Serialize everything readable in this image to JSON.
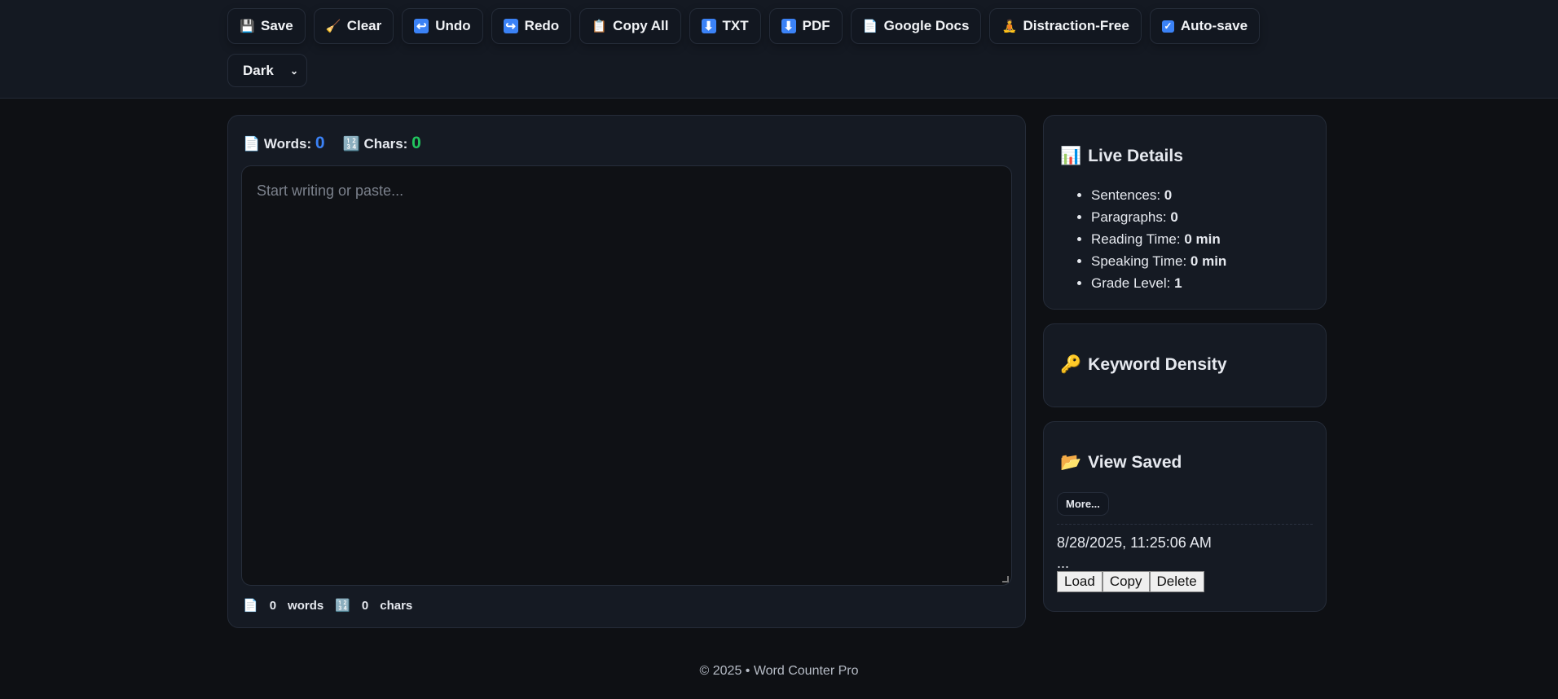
{
  "toolbar": {
    "buttons": [
      {
        "icon": "💾",
        "label": "Save"
      },
      {
        "icon": "🧹",
        "label": "Clear"
      },
      {
        "icon": "↩",
        "label": "Undo"
      },
      {
        "icon": "↪",
        "label": "Redo"
      },
      {
        "icon": "📋",
        "label": "Copy All"
      },
      {
        "icon": "⬇",
        "label": "TXT"
      },
      {
        "icon": "⬇",
        "label": "PDF"
      },
      {
        "icon": "📄",
        "label": "Google Docs"
      },
      {
        "icon": "🧘",
        "label": "Distraction-Free"
      },
      {
        "icon": "☑",
        "label": "Auto-save"
      }
    ],
    "theme_select": "Dark"
  },
  "editor": {
    "words_label": "Words:",
    "words": "0",
    "chars_label": "Chars:",
    "chars": "0",
    "placeholder": "Start writing or paste...",
    "bottom_words": "0",
    "bottom_words_label": "words",
    "bottom_chars": "0",
    "bottom_chars_label": "chars"
  },
  "live": {
    "title": "Live Details",
    "items": [
      {
        "label": "Sentences: ",
        "value": "0"
      },
      {
        "label": "Paragraphs: ",
        "value": "0"
      },
      {
        "label": "Reading Time: ",
        "value": "0 min"
      },
      {
        "label": "Speaking Time: ",
        "value": "0 min"
      },
      {
        "label": "Grade Level: ",
        "value": "1"
      }
    ]
  },
  "keyword": {
    "title": "Keyword Density"
  },
  "saved": {
    "title": "View Saved",
    "more": "More...",
    "entry": {
      "timestamp": "8/28/2025, 11:25:06 AM",
      "preview": "...",
      "load": "Load",
      "copy": "Copy",
      "delete": "Delete"
    }
  },
  "footer": "© 2025 • Word Counter Pro",
  "colors": {
    "words": "#3b82f6",
    "chars": "#22c55e"
  }
}
